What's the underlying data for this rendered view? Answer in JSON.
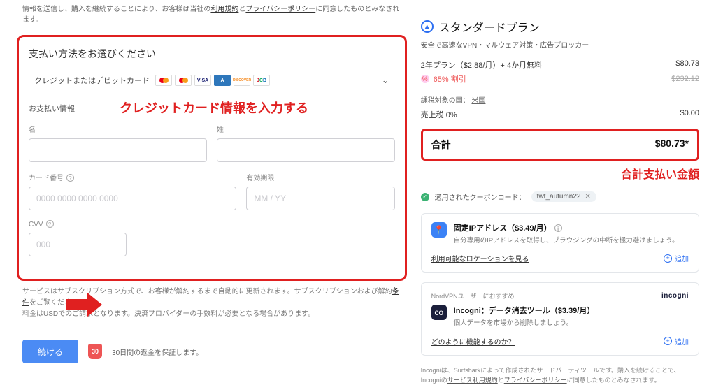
{
  "top_terms": {
    "prefix": "情報を送信し、購入を継続することにより、お客様は当社の",
    "terms": "利用規約",
    "and": "と",
    "privacy": "プライバシーポリシー",
    "suffix": "に同意したものとみなされます。"
  },
  "payment": {
    "section_title": "支払い方法をお選びください",
    "method_label": "クレジットまたはデビットカード",
    "annotation": "クレジットカード情報を入力する",
    "info_title": "お支払い情報",
    "fields": {
      "first_name": "名",
      "last_name": "姓",
      "card_number": "カード番号",
      "card_number_placeholder": "0000 0000 0000 0000",
      "expiry": "有効期限",
      "expiry_placeholder": "MM / YY",
      "cvv": "CVV",
      "cvv_placeholder": "000"
    }
  },
  "below": {
    "line1a": "サービスはサブスクリプション方式で、お客様が解約するまで自動的に更新されます。サブスクリプションおよび解約",
    "line1b": "条件",
    "line1c": "をご覧ください。",
    "line2": "料金はUSDでのご請求となります。決済プロバイダーの手数料が必要となる場合があります。"
  },
  "cta": {
    "continue": "続ける",
    "badge": "30",
    "guarantee": "30日間の返金を保証します。"
  },
  "plan": {
    "title": "スタンダードプラン",
    "subtitle": "安全で高速なVPN・マルウェア対策・広告ブロッカー",
    "line_desc": "2年プラン（$2.88/月）+ 4か月無料",
    "line_price": "$80.73",
    "discount": "65% 割引",
    "original": "$232.12",
    "tax_country_label": "課税対象の国：",
    "tax_country": "米国",
    "tax_label": "売上税 0%",
    "tax_amount": "$0.00",
    "total_label": "合計",
    "total_value": "$80.73*",
    "total_annotation": "合計支払い金額"
  },
  "coupon": {
    "label": "適用されたクーポンコード：",
    "code": "twt_autumn22"
  },
  "addon_ip": {
    "title": "固定IPアドレス（$3.49/月）",
    "desc": "自分専用のIPアドレスを取得し、ブラウジングの中断を極力避けましょう。",
    "link": "利用可能なロケーションを見る",
    "add": "追加"
  },
  "addon_incogni": {
    "tag": "NordVPNユーザーにおすすめ",
    "brand": "incogni",
    "title": "Incogni：データ消去ツール（$3.39/月）",
    "desc": "個人データを市場から削除しましょう。",
    "link": "どのように機能するのか？",
    "add": "追加"
  },
  "footnote": {
    "a": "Incogniは、Surfsharkによって作成されたサードパーティツールです。購入を続けることで、Incogniの",
    "b": "サービス利用規約",
    "c": "と",
    "d": "プライバシーポリシー",
    "e": "に同意したものとみなされます。"
  }
}
